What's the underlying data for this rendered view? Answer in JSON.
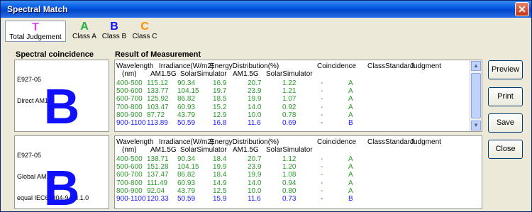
{
  "window": {
    "title": "Spectral Match",
    "close_glyph": "✕"
  },
  "toolbar": [
    {
      "letter": "T",
      "label": "Total Judgement",
      "color": "#e040e0"
    },
    {
      "letter": "A",
      "label": "Class A",
      "color": "#20b040"
    },
    {
      "letter": "B",
      "label": "Class B",
      "color": "#1010ff"
    },
    {
      "letter": "C",
      "label": "Class C",
      "color": "#ff8c00"
    }
  ],
  "labels": {
    "coincidence": "Spectral coincidence",
    "result": "Result of Measurement"
  },
  "colors": {
    "row_green": "#2a9a2a",
    "row_blue": "#1a1aff",
    "big_letter": "#1010ff"
  },
  "panels": [
    {
      "meta": [
        "E927-05",
        "Direct AM1.5"
      ],
      "grade": "B",
      "header1": {
        "wavelength": "Wavelength",
        "irradiance": "Irradiance(W/m2)",
        "energy": "EnergyDistribution(%)",
        "coincidence": "Coincidence",
        "classstd": "ClassStandard",
        "judgment": "Judgment"
      },
      "header2": {
        "nm": "(nm)",
        "am15g": "AM1.5G",
        "solarsim": "SolarSimulator",
        "am15g2": "AM1.5G",
        "solarsim2": "SolarSimulator"
      },
      "rows": [
        [
          "400-500",
          "115.12",
          "90.34",
          "16.9",
          "20.7",
          "1.22",
          "-",
          "A"
        ],
        [
          "500-600",
          "133.77",
          "104.15",
          "19.7",
          "23.9",
          "1.21",
          "-",
          "A"
        ],
        [
          "600-700",
          "125.92",
          "86.82",
          "18.5",
          "19.9",
          "1.07",
          "-",
          "A"
        ],
        [
          "700-800",
          "103.47",
          "60.93",
          "15.2",
          "14.0",
          "0.92",
          "-",
          "A"
        ],
        [
          "800-900",
          "87.72",
          "43.79",
          "12.9",
          "10.0",
          "0.78",
          "-",
          "A"
        ],
        [
          "900-1100",
          "113.89",
          "50.59",
          "16.8",
          "11.6",
          "0.69",
          "-",
          "B"
        ]
      ]
    },
    {
      "meta": [
        "E927-05",
        "Global AM1.5",
        "equal IEC60904-9 Ed.1.0"
      ],
      "grade": "B",
      "header1": {
        "wavelength": "Wavelength",
        "irradiance": "Irradiance(W/m2)",
        "energy": "EnergyDistribution(%)",
        "coincidence": "Coincidence",
        "classstd": "ClassStandard",
        "judgment": "Judgment"
      },
      "header2": {
        "nm": "(nm)",
        "am15g": "AM1.5G",
        "solarsim": "SolarSimulator",
        "am15g2": "AM1.5G",
        "solarsim2": "SolarSimulator"
      },
      "rows": [
        [
          "400-500",
          "138.71",
          "90.34",
          "18.4",
          "20.7",
          "1.12",
          "-",
          "A"
        ],
        [
          "500-600",
          "151.28",
          "104.15",
          "19.9",
          "23.9",
          "1.20",
          "-",
          "A"
        ],
        [
          "600-700",
          "137.47",
          "86.82",
          "18.4",
          "19.9",
          "1.08",
          "-",
          "A"
        ],
        [
          "700-800",
          "111.49",
          "60.93",
          "14.9",
          "14.0",
          "0.94",
          "-",
          "A"
        ],
        [
          "800-900",
          "92.04",
          "43.79",
          "12.5",
          "10.0",
          "0.80",
          "-",
          "A"
        ],
        [
          "900-1100",
          "120.33",
          "50.59",
          "15.9",
          "11.6",
          "0.73",
          "-",
          "B"
        ]
      ]
    }
  ],
  "buttons": {
    "preview": "Preview",
    "print": "Print",
    "save": "Save",
    "close": "Close"
  },
  "scrollbar": {
    "up_glyph": "▲",
    "down_glyph": "▼",
    "grip_glyph": "≡"
  }
}
